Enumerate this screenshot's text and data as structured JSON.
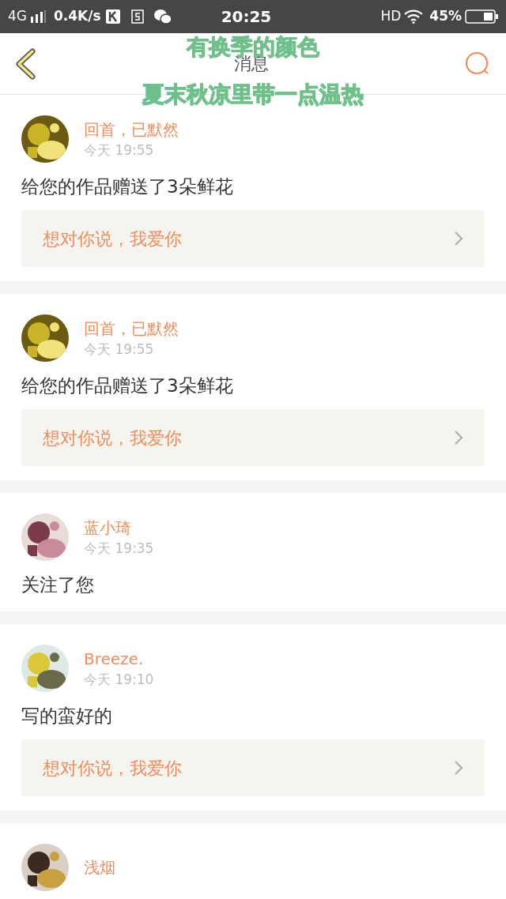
{
  "status_bar": {
    "network": "4G",
    "speed": "0.4K/s",
    "time": "20:25",
    "hd": "HD",
    "battery": "45%"
  },
  "header": {
    "title": "消息"
  },
  "lyrics": {
    "lines": [
      "有换季的颜色",
      "夏末秋凉里带一点温热"
    ]
  },
  "messages": [
    {
      "name": "回首，已默然",
      "time": "今天 19:55",
      "text": "给您的作品赠送了3朵鲜花",
      "reply": "想对你说，我爱你"
    },
    {
      "name": "回首，已默然",
      "time": "今天 19:55",
      "text": "给您的作品赠送了3朵鲜花",
      "reply": "想对你说，我爱你"
    },
    {
      "name": "蓝小琦",
      "time": "今天 19:35",
      "text": "关注了您"
    },
    {
      "name": "Breeze.",
      "time": "今天 19:10",
      "text": "写的蛮好的",
      "reply": "想对你说，我爱你"
    },
    {
      "name": "浅烟"
    }
  ]
}
